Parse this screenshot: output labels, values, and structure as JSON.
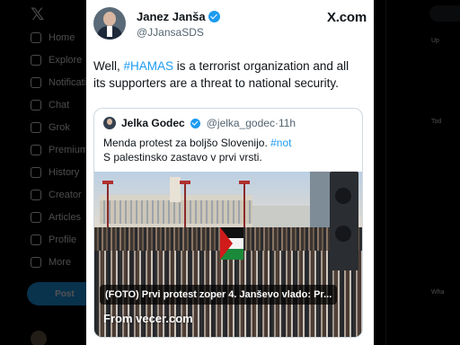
{
  "background": {
    "nav_items": [
      "Home",
      "Explore",
      "Notifications",
      "Chat",
      "Grok",
      "Premium",
      "History",
      "Creator",
      "Articles",
      "Profile",
      "More"
    ],
    "post_button": "Post",
    "right_column": [
      "Up",
      "Tod",
      "Wha"
    ]
  },
  "tweet": {
    "author_name": "Janez Janša",
    "author_handle": "@JJansaSDS",
    "site_label": "X.com",
    "text_prefix": "Well, ",
    "hashtag": "#HAMAS",
    "text_suffix": " is a terrorist organization and all its supporters are a threat to national security."
  },
  "quoted": {
    "author_name": "Jelka Godec",
    "author_handle": "@jelka_godec",
    "time": "11h",
    "line1_prefix": "Menda protest za boljšo Slovenijo. ",
    "line1_hashtag": "#not",
    "line2": "S palestinsko zastavo v prvi vrsti.",
    "caption": "(FOTO) Prvi protest zoper 4. Janševo vlado: Pr...",
    "source": "From vecer.com"
  },
  "colors": {
    "accent": "#1d9bf0",
    "text": "#0f1419",
    "secondary_text": "#536471"
  }
}
